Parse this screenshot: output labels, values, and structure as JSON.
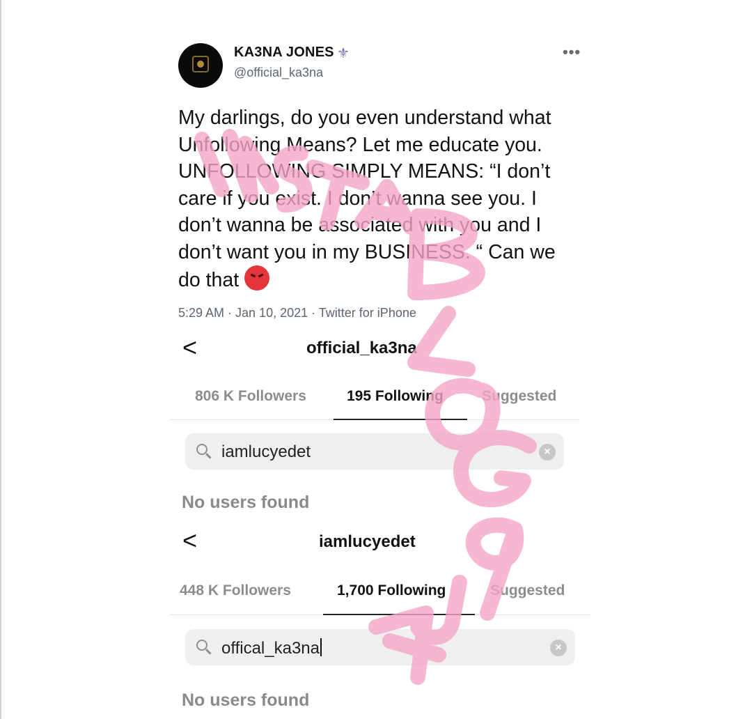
{
  "tweet": {
    "display_name": "KA3NA JONES",
    "verified_glyph": "⚜",
    "handle": "@official_ka3na",
    "more_glyph": "•••",
    "text_lines": [
      "My darlings, do you even understand what",
      "Unfollowing Means? Let me educate you.",
      "UNFOLLOWING SIMPLY MEANS: “I don’t",
      "care if you exist. I don’t wanna see you. I",
      "don’t wanna be associated with you and I",
      "don’t want you in my BUSINESS. “ Can we",
      "do that"
    ],
    "emoji_icon": "angry-face-icon",
    "meta": "5:29 AM · Jan 10, 2021 · Twitter for iPhone"
  },
  "panel1": {
    "back_glyph": "<",
    "title": "official_ka3na",
    "tabs": [
      {
        "label": "806 K Followers"
      },
      {
        "label": "195 Following"
      },
      {
        "label": "Suggested"
      }
    ],
    "active_tab": "195 Following",
    "search_value": "iamlucyedet",
    "clear_glyph": "×",
    "empty_text": "No users found"
  },
  "panel2": {
    "back_glyph": "<",
    "title": "iamlucyedet",
    "tabs": [
      {
        "label": "448 K Followers"
      },
      {
        "label": "1,700 Following"
      },
      {
        "label": "Suggested"
      }
    ],
    "active_tab": "1,700 Following",
    "search_value": "offical_ka3na",
    "clear_glyph": "×",
    "empty_text": "No users found"
  },
  "watermark": {
    "text": "INSTABLOGGIA",
    "color": "#f4a6c6"
  },
  "colors": {
    "watermark_pink": "#f4a6c6",
    "handle_gray": "#5b6670",
    "emoji_red": "#e3353a"
  }
}
